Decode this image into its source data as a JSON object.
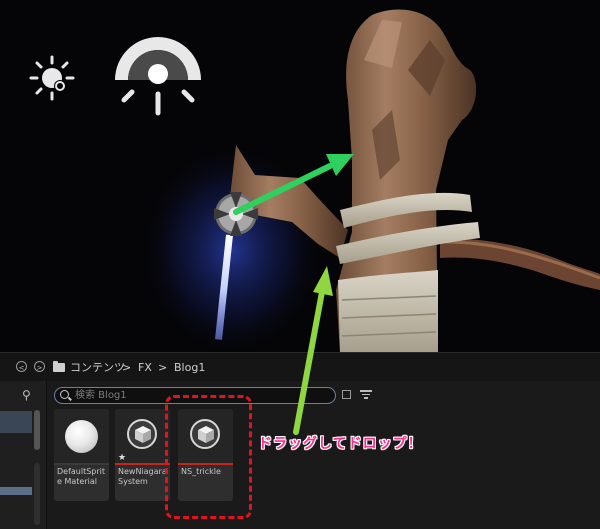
{
  "breadcrumb": {
    "root_label": "コンテンツ",
    "separator": ">",
    "items": [
      "FX",
      "Blog1"
    ]
  },
  "search": {
    "placeholder": "検索 Blog1"
  },
  "assets": [
    {
      "label": "DefaultSprite Material",
      "kind": "material",
      "bar_color": "#3a3a3a"
    },
    {
      "label": "NewNiagara System",
      "kind": "niagara-system",
      "bar_color": "#c8241e"
    },
    {
      "label": "NS_trickle",
      "kind": "niagara-system",
      "bar_color": "#c8241e"
    }
  ],
  "annotation": {
    "text": "ドラッグしてドロップ！",
    "color": "#ff2a8a"
  },
  "colors": {
    "green_arrow": "#2fd15e",
    "lime_arrow": "#8fd640",
    "dashed_highlight": "#e0141e"
  }
}
